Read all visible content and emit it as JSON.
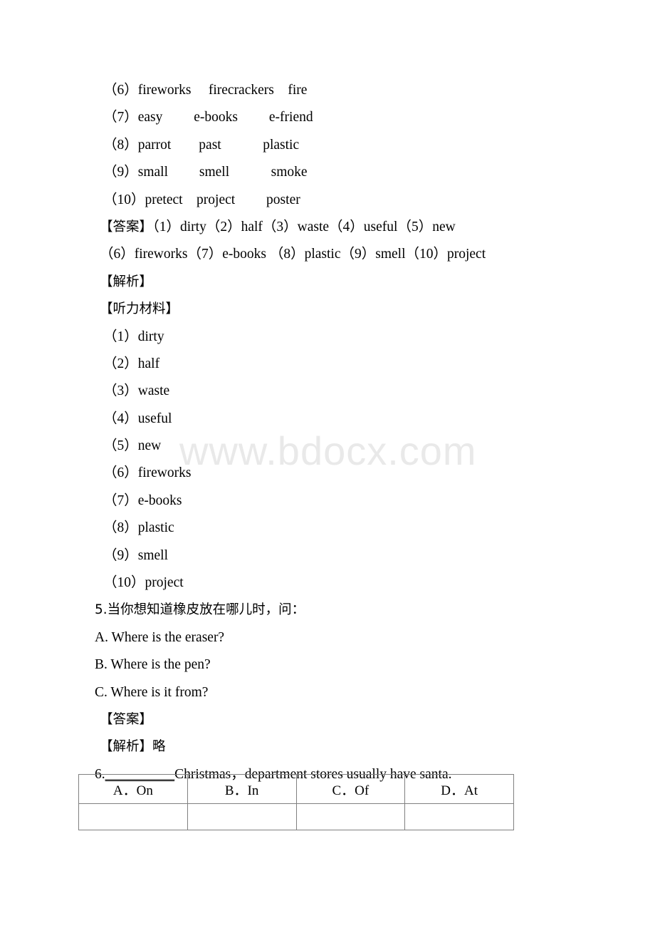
{
  "document": {
    "watermark": "www.bdocx.com",
    "word_choice_lines": [
      "（6）fireworks　 firecrackers　fire",
      "（7）easy　　 e-books　　 e-friend",
      "（8）parrot　　past　　　plastic",
      "（9）small　　 smell　　　smoke",
      "（10）pretect　project　　 poster"
    ],
    "answer_block": {
      "label": "【答案】",
      "line1_items": "（1）dirty（2）half（3）waste（4）useful（5）new",
      "line2_items": "（6）fireworks（7）e-books （8）plastic（9）smell（10）project"
    },
    "analysis_label": "【解析】",
    "listening_label": "【听力材料】",
    "listening_items": [
      "（1）dirty",
      "（2）half",
      "（3）waste",
      "（4）useful",
      "（5）new",
      "（6）fireworks",
      "（7）e-books",
      "（8）plastic",
      "（9）smell",
      "（10）project"
    ],
    "question5": {
      "stem": "5.当你想知道橡皮放在哪儿时，问：",
      "options": [
        "A. Where is the eraser?",
        "B. Where is the pen?",
        "C. Where is it from?"
      ],
      "answer_label": "【答案】",
      "analysis_label": "【解析】略"
    },
    "question6": {
      "number": "6.",
      "blank": "__________",
      "stem_rest": "Christmas，department stores usually have santa.",
      "options_table": {
        "headers": [
          "A．On",
          "B．In",
          "C．Of",
          "D．At"
        ],
        "answer_row": [
          "",
          "",
          "",
          ""
        ]
      }
    }
  }
}
